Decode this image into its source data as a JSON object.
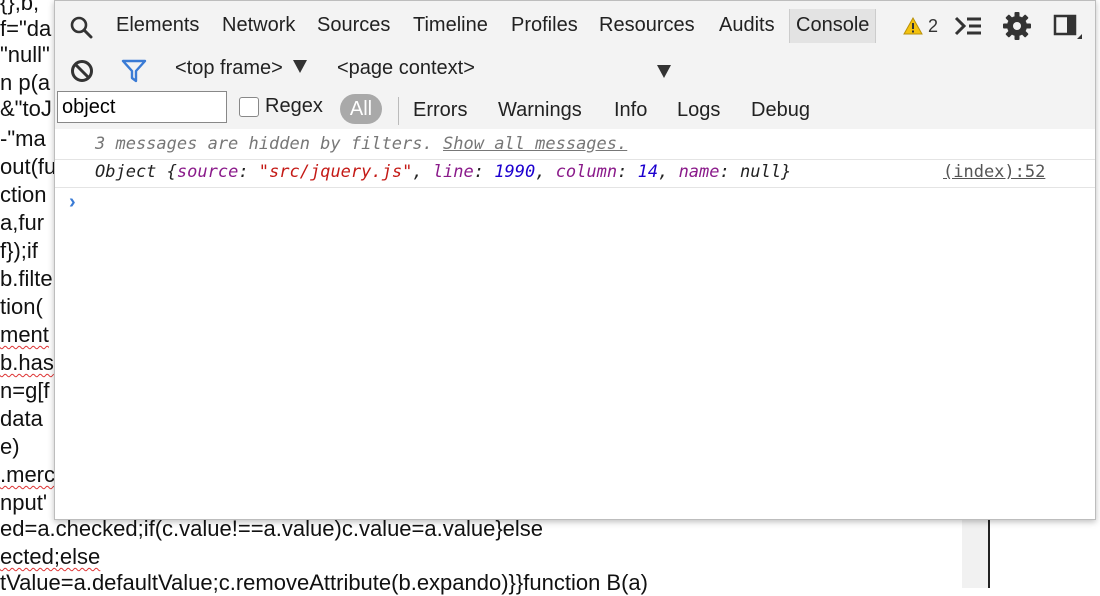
{
  "background_code": {
    "lines": [
      "{},b,",
      "f=\"da",
      "\"null\"",
      "n p(a",
      "&\"toJ",
      "-\"ma",
      "out(fu",
      "ction",
      "a,fur",
      "f});if",
      "b.filte",
      "tion(",
      "ment",
      "b.has",
      "n=g[f",
      "data",
      "e)",
      ".merc",
      "nput'",
      "ed=a.checked;if(c.value!==a.value)c.value=a.value}else",
      "ected;else",
      "tValue=a.defaultValue;c.removeAttribute(b.expando)}}function B(a)"
    ]
  },
  "tabs": [
    "Elements",
    "Network",
    "Sources",
    "Timeline",
    "Profiles",
    "Resources",
    "Audits",
    "Console"
  ],
  "active_tab": "Console",
  "warnings_count": "2",
  "toolbar": {
    "frame": "<top frame>",
    "context": "<page context>"
  },
  "filter": {
    "value": "object",
    "regex_label": "Regex",
    "all_label": "All",
    "levels": [
      "Errors",
      "Warnings",
      "Info",
      "Logs",
      "Debug"
    ]
  },
  "console": {
    "hidden_text": "3 messages are hidden by filters.",
    "show_all_link": "Show all messages.",
    "object_message": {
      "prefix": "Object {",
      "k1": "source",
      "v1": "\"src/jquery.js\"",
      "k2": "line",
      "v2": "1990",
      "k3": "column",
      "v3": "14",
      "k4": "name",
      "v4": "null",
      "suffix": "}"
    },
    "source_link": "(index):52",
    "prompt": "›"
  },
  "colors": {
    "accent_blue": "#3a7bd5",
    "warning_yellow": "#f4c20d",
    "string_red": "#c41a16",
    "number_blue": "#1c00cf",
    "key_purple": "#8a1a8a"
  }
}
